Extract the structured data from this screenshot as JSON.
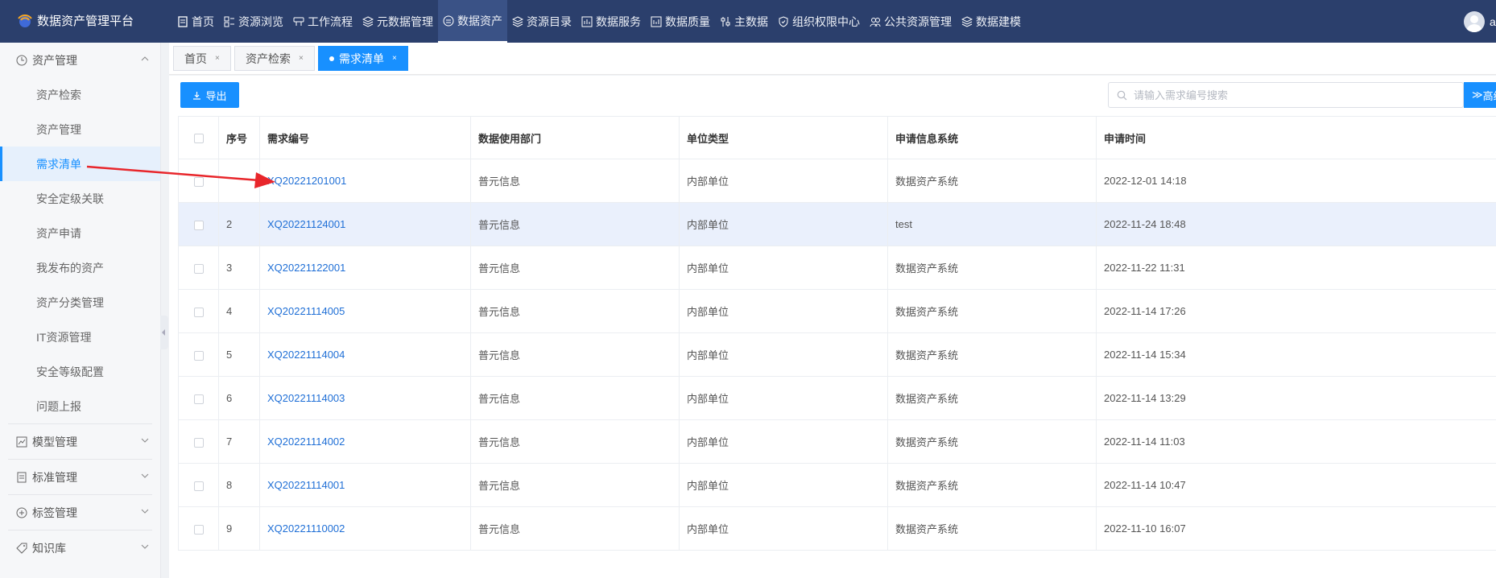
{
  "app": {
    "title": "数据资产管理平台",
    "user_initial": "a"
  },
  "nav": [
    {
      "label": "首页",
      "icon": "document-icon"
    },
    {
      "label": "资源浏览",
      "icon": "grid-icon"
    },
    {
      "label": "工作流程",
      "icon": "flow-icon"
    },
    {
      "label": "元数据管理",
      "icon": "layers-icon"
    },
    {
      "label": "数据资产",
      "icon": "circle-list-icon"
    },
    {
      "label": "资源目录",
      "icon": "layers-icon"
    },
    {
      "label": "数据服务",
      "icon": "chart-icon"
    },
    {
      "label": "数据质量",
      "icon": "chart-icon"
    },
    {
      "label": "主数据",
      "icon": "sliders-icon"
    },
    {
      "label": "组织权限中心",
      "icon": "shield-icon"
    },
    {
      "label": "公共资源管理",
      "icon": "users-icon"
    },
    {
      "label": "数据建模",
      "icon": "layers-icon"
    }
  ],
  "sidebar": {
    "groups": [
      {
        "label": "资产管理",
        "icon": "clock-icon",
        "expanded": true,
        "items": [
          {
            "label": "资产检索"
          },
          {
            "label": "资产管理"
          },
          {
            "label": "需求清单"
          },
          {
            "label": "安全定级关联"
          },
          {
            "label": "资产申请"
          },
          {
            "label": "我发布的资产"
          },
          {
            "label": "资产分类管理"
          },
          {
            "label": "IT资源管理"
          },
          {
            "label": "安全等级配置"
          },
          {
            "label": "问题上报"
          }
        ]
      },
      {
        "label": "模型管理",
        "icon": "chart-icon"
      },
      {
        "label": "标准管理",
        "icon": "document-icon"
      },
      {
        "label": "标签管理",
        "icon": "plus-circle-icon"
      },
      {
        "label": "知识库",
        "icon": "tag-icon"
      }
    ]
  },
  "tabs": [
    {
      "label": "首页",
      "close": "×"
    },
    {
      "label": "资产检索",
      "close": "×"
    },
    {
      "label": "需求清单",
      "close": "×"
    }
  ],
  "toolbar": {
    "export_label": "导出",
    "search_placeholder": "请输入需求编号搜索",
    "advanced_label": "高级"
  },
  "table": {
    "columns": [
      "序号",
      "需求编号",
      "数据使用部门",
      "单位类型",
      "申请信息系统",
      "申请时间"
    ],
    "rows": [
      {
        "index": "1",
        "code": "XQ20221201001",
        "dept": "普元信息",
        "unit_type": "内部单位",
        "system": "数据资产系统",
        "time": "2022-12-01 14:18"
      },
      {
        "index": "2",
        "code": "XQ20221124001",
        "dept": "普元信息",
        "unit_type": "内部单位",
        "system": "test",
        "time": "2022-11-24 18:48"
      },
      {
        "index": "3",
        "code": "XQ20221122001",
        "dept": "普元信息",
        "unit_type": "内部单位",
        "system": "数据资产系统",
        "time": "2022-11-22 11:31"
      },
      {
        "index": "4",
        "code": "XQ20221114005",
        "dept": "普元信息",
        "unit_type": "内部单位",
        "system": "数据资产系统",
        "time": "2022-11-14 17:26"
      },
      {
        "index": "5",
        "code": "XQ20221114004",
        "dept": "普元信息",
        "unit_type": "内部单位",
        "system": "数据资产系统",
        "time": "2022-11-14 15:34"
      },
      {
        "index": "6",
        "code": "XQ20221114003",
        "dept": "普元信息",
        "unit_type": "内部单位",
        "system": "数据资产系统",
        "time": "2022-11-14 13:29"
      },
      {
        "index": "7",
        "code": "XQ20221114002",
        "dept": "普元信息",
        "unit_type": "内部单位",
        "system": "数据资产系统",
        "time": "2022-11-14 11:03"
      },
      {
        "index": "8",
        "code": "XQ20221114001",
        "dept": "普元信息",
        "unit_type": "内部单位",
        "system": "数据资产系统",
        "time": "2022-11-14 10:47"
      },
      {
        "index": "9",
        "code": "XQ20221110002",
        "dept": "普元信息",
        "unit_type": "内部单位",
        "system": "数据资产系统",
        "time": "2022-11-10 16:07"
      }
    ]
  },
  "colors": {
    "topbar": "#2b3f6c",
    "accent": "#1890ff",
    "link": "#1f6fd6",
    "annotation_arrow": "#e8262b"
  }
}
